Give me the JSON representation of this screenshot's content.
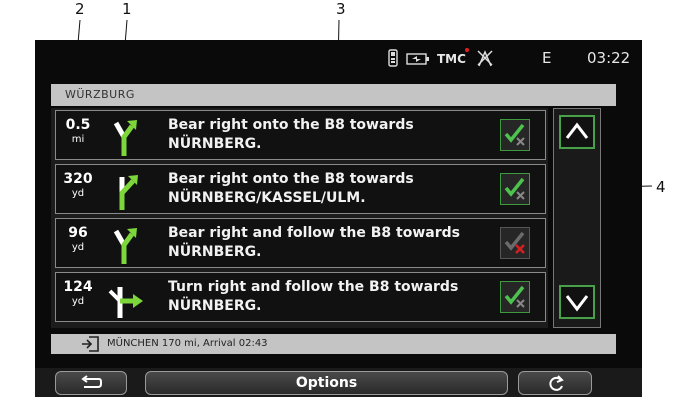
{
  "callouts": [
    "2",
    "1",
    "3",
    "4"
  ],
  "status": {
    "tmc": "TMC",
    "compass_letter": "E",
    "time": "03:22"
  },
  "route_header": "WÜRZBURG",
  "rows": [
    {
      "distance": "0.5",
      "unit": "mi",
      "line1": "Bear right onto the B8 towards",
      "line2": "NÜRNBERG.",
      "turn_icon": "bear-right-icon",
      "check_state": "enabled"
    },
    {
      "distance": "320",
      "unit": "yd",
      "line1": "Bear right onto the B8 towards",
      "line2": "NÜRNBERG/KASSEL/ULM.",
      "turn_icon": "bear-right-icon",
      "check_state": "enabled"
    },
    {
      "distance": "96",
      "unit": "yd",
      "line1": "Bear right and follow the B8 towards",
      "line2": "NÜRNBERG.",
      "turn_icon": "bear-right-icon",
      "check_state": "excluded"
    },
    {
      "distance": "124",
      "unit": "yd",
      "line1": "Turn right and follow the B8 towards",
      "line2": "NÜRNBERG.",
      "turn_icon": "turn-right-icon",
      "check_state": "enabled"
    }
  ],
  "destination_line": "MÜNCHEN 170 mi, Arrival 02:43",
  "buttons": {
    "back_icon": "back-arrow-icon",
    "options_label": "Options",
    "refresh_icon": "refresh-icon"
  },
  "colors": {
    "accent_green": "#48a048",
    "exclude_red": "#d42020"
  }
}
